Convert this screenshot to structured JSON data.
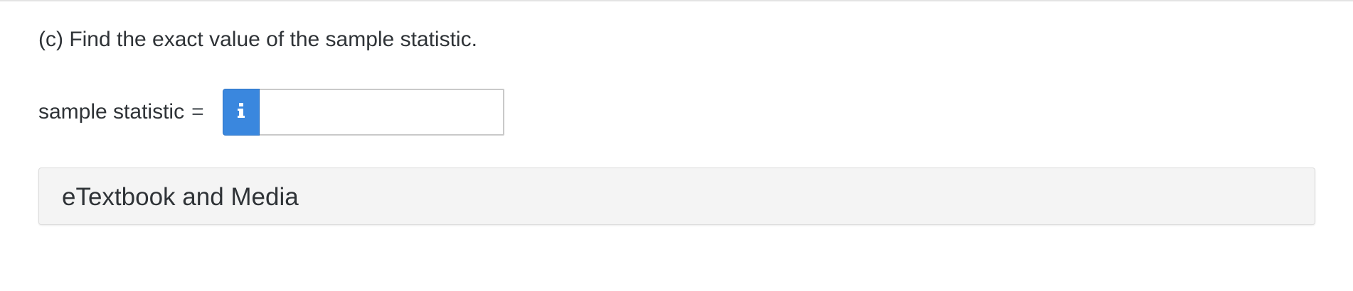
{
  "question": {
    "text": "(c) Find the exact value of the sample statistic."
  },
  "answer": {
    "label": "sample statistic",
    "equals": "=",
    "value": "",
    "info_icon": "info-icon"
  },
  "media": {
    "title": "eTextbook and Media"
  },
  "colors": {
    "accent": "#3a87de",
    "text": "#2f3337",
    "panel_bg": "#f4f4f4"
  }
}
